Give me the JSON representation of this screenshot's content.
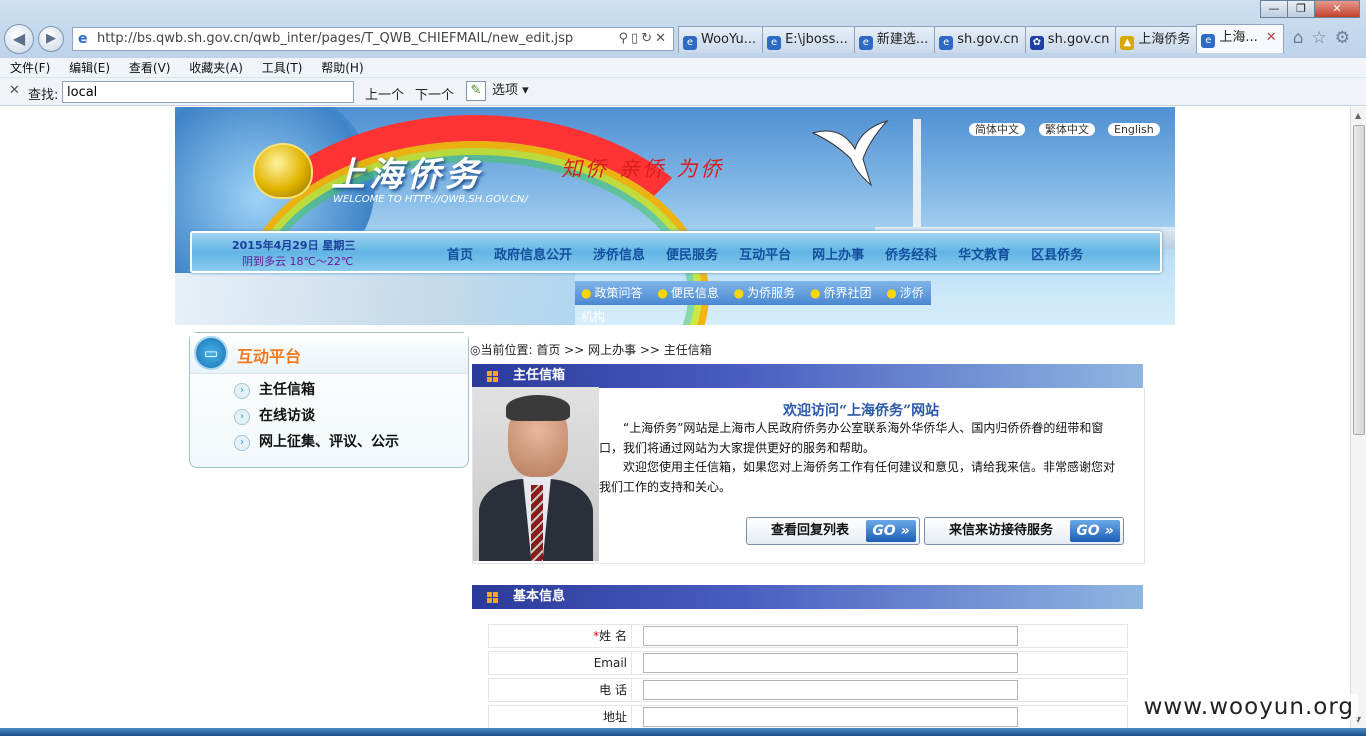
{
  "browser": {
    "url": "http://bs.qwb.sh.gov.cn/qwb_inter/pages/T_QWB_CHIEFMAIL/new_edit.jsp",
    "window_controls": [
      "—",
      "❐",
      "✕"
    ],
    "tabs": [
      {
        "label": "WooYu...",
        "icon": "ie-icon"
      },
      {
        "label": "E:\\jboss...",
        "icon": "ie-icon"
      },
      {
        "label": "新建选...",
        "icon": "ie-icon"
      },
      {
        "label": "sh.gov.cn",
        "icon": "ie-icon"
      },
      {
        "label": "sh.gov.cn",
        "icon": "paw-icon"
      },
      {
        "label": "上海侨务",
        "icon": "site-icon"
      },
      {
        "label": "上海...",
        "icon": "ie-icon",
        "active": true
      }
    ],
    "menu": [
      "文件(F)",
      "编辑(E)",
      "查看(V)",
      "收藏夹(A)",
      "工具(T)",
      "帮助(H)"
    ],
    "find": {
      "label": "查找:",
      "value": "local",
      "prev": "上一个",
      "next": "下一个",
      "options": "选项"
    }
  },
  "banner": {
    "title": "上海侨务",
    "url_text": "WELCOME TO HTTP://QWB.SH.GOV.CN/",
    "slogan": "知侨  亲侨  为侨",
    "languages": [
      "简体中文",
      "繁体中文",
      "English"
    ]
  },
  "navbar": {
    "date": "2015年4月29日 星期三",
    "weather": "阴到多云 18℃～22℃",
    "items": [
      "首页",
      "政府信息公开",
      "涉侨信息",
      "便民服务",
      "互动平台",
      "网上办事",
      "侨务经科",
      "华文教育",
      "区县侨务"
    ],
    "subitems": [
      "政策问答",
      "便民信息",
      "为侨服务",
      "侨界社团",
      "涉侨机构"
    ]
  },
  "sidebar": {
    "title": "互动平台",
    "items": [
      "主任信箱",
      "在线访谈",
      "网上征集、评议、公示"
    ]
  },
  "breadcrumb": "◎当前位置: 首页 >> 网上办事 >> 主任信箱",
  "mailbox": {
    "section_title": "主任信箱",
    "welcome": "欢迎访问“上海侨务”网站",
    "para1": "“上海侨务”网站是上海市人民政府侨务办公室联系海外华侨华人、国内归侨侨眷的纽带和窗口，我们将通过网站为大家提供更好的服务和帮助。",
    "para2": "欢迎您使用主任信箱，如果您对上海侨务工作有任何建议和意见，请给我来信。非常感谢您对我们工作的支持和关心。",
    "btn_reply_list": "查看回复列表",
    "btn_visit": "来信来访接待服务",
    "go": "GO »"
  },
  "basic_info": {
    "section_title": "基本信息",
    "fields": [
      {
        "label": "姓 名",
        "required": true
      },
      {
        "label": "Email",
        "required": false
      },
      {
        "label": "电 话",
        "required": false
      },
      {
        "label": "地址",
        "required": false
      }
    ]
  },
  "watermark": "www.wooyun.org"
}
